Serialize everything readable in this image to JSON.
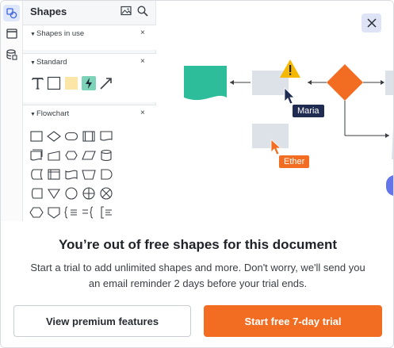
{
  "panel": {
    "title": "Shapes",
    "header_icons": [
      "image-icon",
      "search-icon"
    ],
    "sections": {
      "in_use": {
        "title": "Shapes in use",
        "close": "×"
      },
      "standard": {
        "title": "Standard",
        "close": "×"
      },
      "flowchart": {
        "title": "Flowchart",
        "close": "×"
      }
    }
  },
  "sidebar_icons": [
    "shapes-icon",
    "page-icon",
    "data-icon"
  ],
  "canvas": {
    "cursor_labels": {
      "maria": "Maria",
      "ether": "Ether"
    },
    "colors": {
      "teal": "#2dbd9b",
      "orange": "#f26d21",
      "warning": "#f5b800",
      "maria_tag": "#202b52",
      "ether_tag": "#f26d21",
      "placeholder": "#dde1e8"
    }
  },
  "dialog": {
    "close_icon": "close-icon",
    "headline": "You’re out of free shapes for this document",
    "body": "Start a trial to add unlimited shapes and more. Don't worry, we'll send you an email reminder 2 days before your trial ends.",
    "secondary_button": "View premium features",
    "primary_button": "Start free 7-day trial",
    "colors": {
      "primary": "#f26d21"
    }
  }
}
